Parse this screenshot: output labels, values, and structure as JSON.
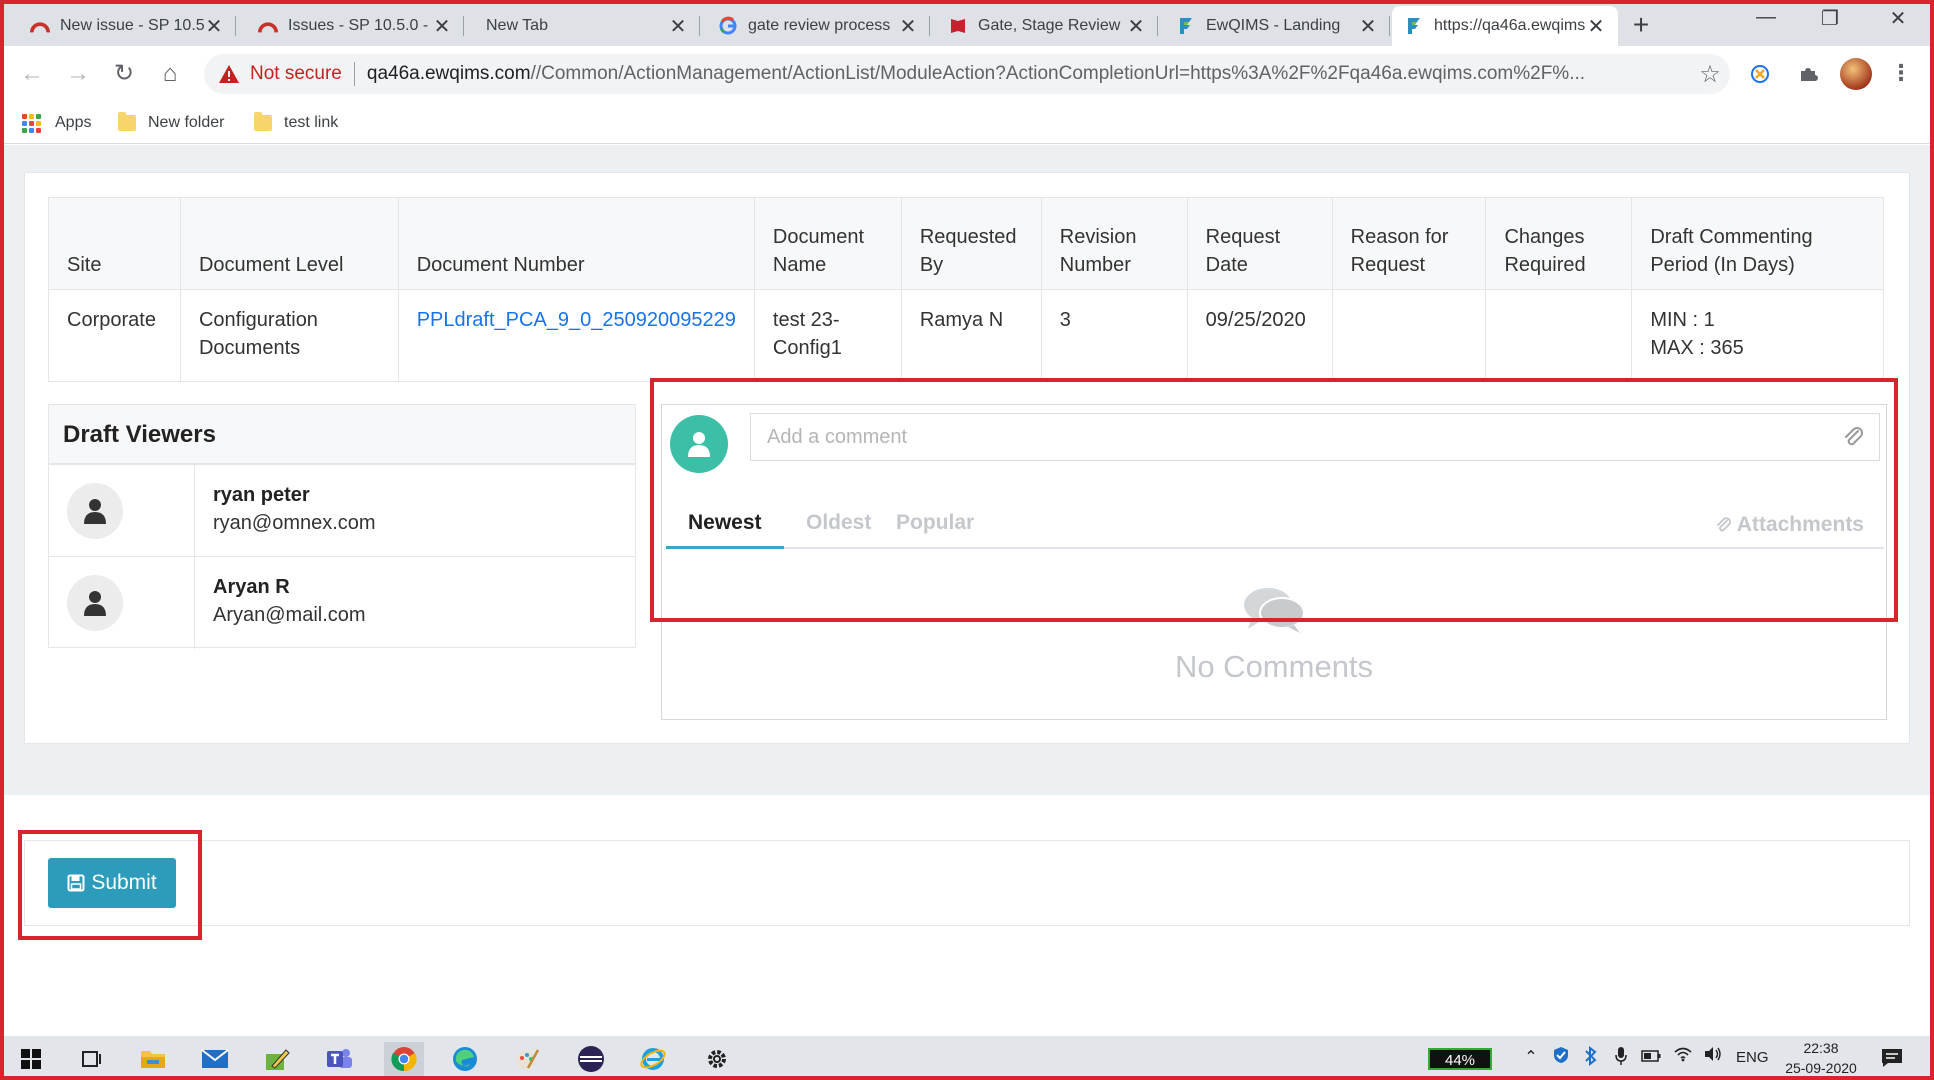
{
  "browser": {
    "tabs": [
      {
        "title": "New issue - SP 10.5",
        "icon": "jira-icon"
      },
      {
        "title": "Issues - SP 10.5.0 -",
        "icon": "jira-icon"
      },
      {
        "title": "New Tab",
        "icon": "none"
      },
      {
        "title": "gate review process",
        "icon": "google-icon"
      },
      {
        "title": "Gate, Stage Review",
        "icon": "pdf-icon"
      },
      {
        "title": "EwQIMS - Landing",
        "icon": "ewqims-icon"
      },
      {
        "title": "https://qa46a.ewqims",
        "icon": "ewqims-icon"
      }
    ],
    "active_tab": 6,
    "address": {
      "security_label": "Not secure",
      "url_host": "qa46a.ewqims.com",
      "url_path": "//Common/ActionManagement/ActionList/ModuleAction?ActionCompletionUrl=https%3A%2F%2Fqa46a.ewqims.com%2F%..."
    },
    "bookmarks": [
      {
        "label": "Apps"
      },
      {
        "label": "New folder"
      },
      {
        "label": "test link"
      }
    ]
  },
  "document_table": {
    "headers": {
      "site": "Site",
      "level": "Document Level",
      "number": "Document Number",
      "name": "Document Name",
      "requested_by": "Requested By",
      "revision": "Revision Number",
      "request_date": "Request Date",
      "reason": "Reason for Request",
      "changes": "Changes Required",
      "period": "Draft Commenting Period (In Days)"
    },
    "row": {
      "site": "Corporate",
      "level": "Configuration Documents",
      "number": "PPLdraft_PCA_9_0_250920095229",
      "name": "test 23-Config1",
      "requested_by": "Ramya N",
      "revision": "3",
      "request_date": "09/25/2020",
      "reason": "",
      "changes": "",
      "period_min": "MIN : 1",
      "period_max": "MAX : 365"
    }
  },
  "draft_viewers": {
    "title": "Draft Viewers",
    "viewers": [
      {
        "name": "ryan peter",
        "email": "ryan@omnex.com"
      },
      {
        "name": "Aryan R",
        "email": "Aryan@mail.com"
      }
    ]
  },
  "comments": {
    "placeholder": "Add a comment",
    "tabs": [
      "Newest",
      "Oldest",
      "Popular"
    ],
    "active_tab": "Newest",
    "attachments_label": "Attachments",
    "empty_text": "No Comments"
  },
  "submit": {
    "label": "Submit"
  },
  "taskbar": {
    "battery": "44%",
    "language": "ENG",
    "time": "22:38",
    "date": "25-09-2020"
  },
  "colors": {
    "highlight": "#d9232d",
    "accent": "#2d9bbb",
    "avatar": "#3dbfa7",
    "link": "#1a73e8",
    "tab_underline": "#3aa6c5"
  }
}
